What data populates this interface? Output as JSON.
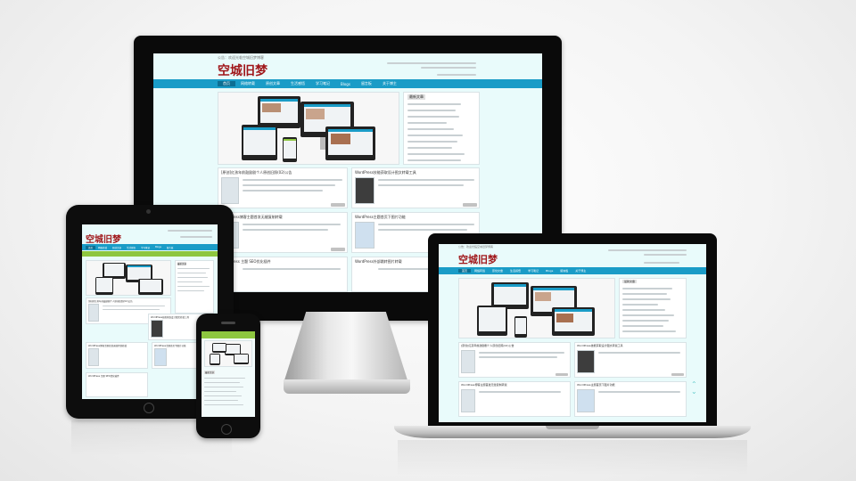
{
  "site": {
    "logo": "空城旧梦",
    "top_notice": "公告：欢迎光临空城旧梦博客",
    "nav": [
      "首页",
      "网络转载",
      "原创文章",
      "生活感悟",
      "学习笔记",
      "Blogs",
      "留言板",
      "关于博主"
    ],
    "nav_active_index": 0,
    "sidebar_title": "最新文章",
    "posts": [
      "[原创]红孩年前鼓励剧个人原创旧照(02)公告",
      "WordPress技能获取设计图文转载工具",
      "WordPress博客主题首发无缝复制转载",
      "WordPress主题首页下图片功能",
      "WordPress 主题 SEO优化插件",
      "WordPress外部跳转图片转载"
    ],
    "colors": {
      "nav": "#1a9cc7",
      "logo": "#a0171a",
      "background": "#e9fbfb",
      "phone_nav": "#8dc63f"
    }
  }
}
